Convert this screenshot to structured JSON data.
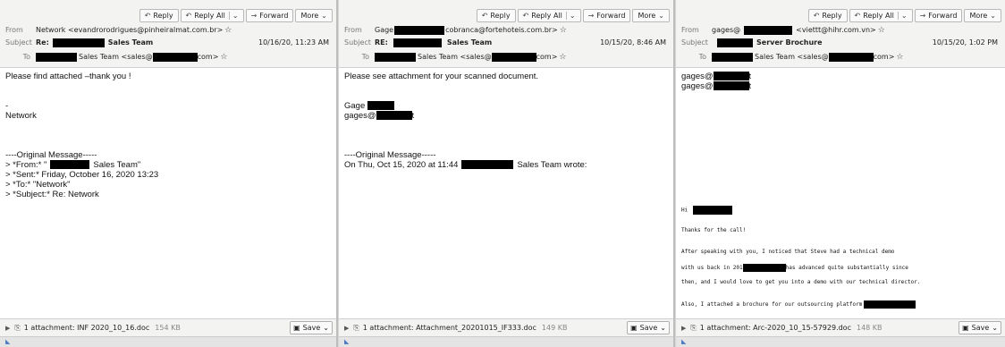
{
  "toolbar": {
    "reply": "Reply",
    "reply_all": "Reply All",
    "forward": "Forward",
    "more": "More"
  },
  "labels": {
    "from": "From",
    "subject": "Subject",
    "to": "To"
  },
  "panes": [
    {
      "from_a": "Network <evandrorodrigues@pinheiralmat.com.br>",
      "from_b": "",
      "subject_prefix": "Re:",
      "subject_tail": "Sales Team",
      "date": "10/16/20, 11:23 AM",
      "to_a": "Sales Team <sales@",
      "to_b": "com>",
      "body": [
        "Please find attached –thank you !",
        "",
        "",
        "-",
        "Network",
        "",
        "",
        "",
        "----Original Message-----",
        "> *From:* \"",
        "> *Sent:* Friday, October 16, 2020 13:23",
        "> *To:* \"Network\"",
        "> *Subject:* Re: Network"
      ],
      "from_line_tail": "Sales Team\"",
      "attachment": "1 attachment: INF 2020_10_16.doc",
      "attachment_size": "154 KB",
      "save": "Save"
    },
    {
      "from_a": "Gage",
      "from_b": "cobranca@fortehoteis.com.br>",
      "subject_prefix": "RE:",
      "subject_tail": "Sales Team",
      "date": "10/15/20, 8:46 AM",
      "to_a": "Sales Team <sales@",
      "to_b": "com>",
      "body": [
        "Please see attachment for your scanned document.",
        "",
        "",
        "Gage",
        "gages@",
        "",
        "",
        "",
        "----Original Message-----",
        "On Thu, Oct 15, 2020 at 11:44"
      ],
      "wrote_tail": "Sales Team wrote:",
      "gages_tail": "t",
      "attachment": "1 attachment: Attachment_20201015_IF333.doc",
      "attachment_size": "149 KB",
      "save": "Save"
    },
    {
      "from_a": "gages@",
      "from_b": "<viettt@hihr.com.vn>",
      "subject_prefix": "",
      "subject_tail": "Server Brochure",
      "date": "10/15/20, 1:02 PM",
      "to_a": "Sales Team <sales@",
      "to_b": "com>",
      "body_top": [
        "gages@",
        "gages@"
      ],
      "body_top_tail": "t",
      "hi": "Hi",
      "thanks": "Thanks for the call!",
      "para1": "After speaking with you, I noticed that Steve had a technical demo",
      "para2a": "with us back in 201",
      "para2b": "has advanced quite substantially since",
      "para3": "then, and I would love to get you into a demo with our technical director.",
      "para4": "Also, I attached a brochure for our outsourcing platform",
      "attachment": "1 attachment: Arc-2020_10_15-57929.doc",
      "attachment_size": "148 KB",
      "save": "Save"
    }
  ],
  "icons": [
    "reply-icon",
    "reply-all-icon",
    "forward-icon",
    "chevron-down-icon",
    "star-icon",
    "paperclip-icon",
    "twisty-icon",
    "save-icon",
    "status-icon"
  ]
}
